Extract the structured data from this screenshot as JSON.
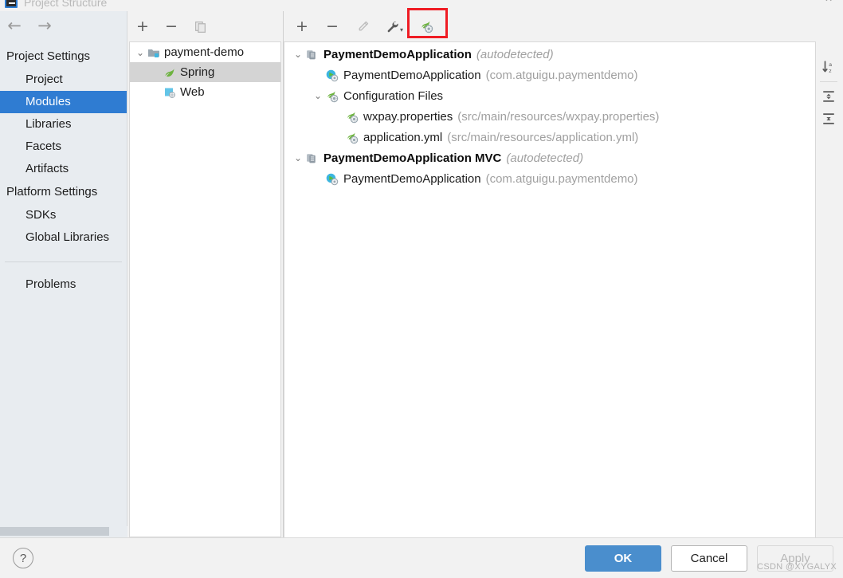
{
  "window": {
    "title": "Project Structure",
    "close_label": "×"
  },
  "sidebar": {
    "nav": {
      "back": "←",
      "forward": "→"
    },
    "groups": [
      {
        "label": "Project Settings",
        "items": [
          {
            "label": "Project",
            "selected": false
          },
          {
            "label": "Modules",
            "selected": true
          },
          {
            "label": "Libraries",
            "selected": false
          },
          {
            "label": "Facets",
            "selected": false
          },
          {
            "label": "Artifacts",
            "selected": false
          }
        ]
      },
      {
        "label": "Platform Settings",
        "items": [
          {
            "label": "SDKs",
            "selected": false
          },
          {
            "label": "Global Libraries",
            "selected": false
          }
        ]
      }
    ],
    "extra_items": [
      {
        "label": "Problems",
        "selected": false
      }
    ]
  },
  "modules_panel": {
    "toolbar": [
      {
        "name": "add-module-button",
        "glyph": "+"
      },
      {
        "name": "remove-module-button",
        "glyph": "−"
      },
      {
        "name": "copy-module-button",
        "glyph": "❐"
      }
    ],
    "tree": [
      {
        "indent": 0,
        "chevron": "⌄",
        "icon": "module-folder-icon",
        "label": "payment-demo",
        "selected": false
      },
      {
        "indent": 1,
        "chevron": "",
        "icon": "spring-leaf-icon",
        "label": "Spring",
        "selected": true
      },
      {
        "indent": 1,
        "chevron": "",
        "icon": "web-facet-icon",
        "label": "Web",
        "selected": false
      }
    ]
  },
  "detail_panel": {
    "toolbar": [
      {
        "name": "add-context-button",
        "glyph": "+",
        "enabled": true,
        "highlighted": false
      },
      {
        "name": "remove-context-button",
        "glyph": "−",
        "enabled": true,
        "highlighted": false
      },
      {
        "name": "edit-context-button",
        "glyph": "pencil-icon",
        "enabled": false,
        "highlighted": false
      },
      {
        "name": "configure-wrench-button",
        "glyph": "wrench-icon",
        "enabled": true,
        "highlighted": false
      },
      {
        "name": "spring-config-file-button",
        "glyph": "spring-config-icon",
        "enabled": true,
        "highlighted": true
      }
    ],
    "right_toolbar": [
      {
        "name": "sort-alphabetically-button",
        "glyph": "sort-az-icon"
      },
      {
        "name": "expand-all-button",
        "glyph": "expand-all-icon"
      },
      {
        "name": "collapse-all-button",
        "glyph": "collapse-all-icon"
      }
    ],
    "tree": [
      {
        "indent": 0,
        "chevron": "⌄",
        "icon": "spring-context-icon",
        "label": "PaymentDemoApplication",
        "bold": true,
        "suffix": "(autodetected)",
        "suffix_style": "italic"
      },
      {
        "indent": 1,
        "chevron": "",
        "icon": "spring-bean-class-icon",
        "label": "PaymentDemoApplication",
        "bold": false,
        "suffix": "(com.atguigu.paymentdemo)",
        "suffix_style": "plain"
      },
      {
        "indent": 1,
        "chevron": "⌄",
        "icon": "spring-config-icon",
        "label": "Configuration Files",
        "bold": false,
        "suffix": "",
        "suffix_style": "plain"
      },
      {
        "indent": 2,
        "chevron": "",
        "icon": "spring-config-icon",
        "label": "wxpay.properties",
        "bold": false,
        "suffix": "(src/main/resources/wxpay.properties)",
        "suffix_style": "plain"
      },
      {
        "indent": 2,
        "chevron": "",
        "icon": "spring-config-icon",
        "label": "application.yml",
        "bold": false,
        "suffix": "(src/main/resources/application.yml)",
        "suffix_style": "plain"
      },
      {
        "indent": 0,
        "chevron": "⌄",
        "icon": "spring-context-icon",
        "label": "PaymentDemoApplication MVC",
        "bold": true,
        "suffix": "(autodetected)",
        "suffix_style": "italic"
      },
      {
        "indent": 1,
        "chevron": "",
        "icon": "spring-bean-class-icon",
        "label": "PaymentDemoApplication",
        "bold": false,
        "suffix": "(com.atguigu.paymentdemo)",
        "suffix_style": "plain"
      }
    ]
  },
  "footer": {
    "help_label": "?",
    "ok_label": "OK",
    "cancel_label": "Cancel",
    "apply_label": "Apply"
  },
  "watermark": "CSDN @XYGALYX",
  "colors": {
    "selection_blue": "#2f7cd2",
    "primary_button": "#4a8ecd",
    "highlight_red": "#ef1c24",
    "muted_text": "#a0a0a0",
    "tree_selection_gray": "#d4d4d4"
  }
}
